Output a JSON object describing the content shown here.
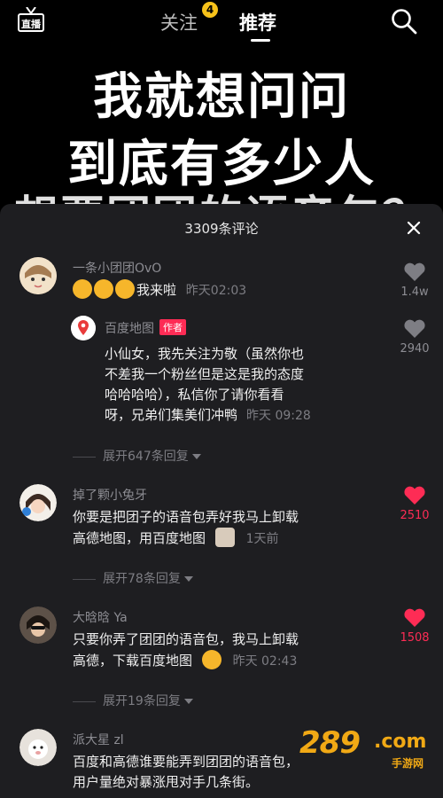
{
  "topbar": {
    "live_label": "直播",
    "follow_label": "关注",
    "follow_badge": "4",
    "recommend_label": "推荐"
  },
  "caption": {
    "line1": "我就想问问",
    "line2": "到底有多少人",
    "line3": "想要团团的语音包？"
  },
  "comments_sheet": {
    "title": "3309条评论",
    "comments": [
      {
        "username": "一条小团团OvO",
        "text": "我来啦",
        "time": "昨天02:03",
        "likes": "1.4w",
        "liked": false,
        "emoji_count": 3
      },
      {
        "username": "百度地图",
        "author_tag": "作者",
        "lines": [
          "小仙女，我先关注为敬（虽然你也",
          "不差我一个粉丝但是这是我的态度",
          "哈哈哈哈），私信你了请你看看",
          "呀，兄弟们集美们冲鸭"
        ],
        "time": "昨天 09:28",
        "likes": "2940",
        "liked": false,
        "expand": "展开647条回复"
      },
      {
        "username": "掉了颗小兔牙",
        "lines": [
          "你要是把团子的语音包弄好我马上卸载",
          "高德地图，用百度地图"
        ],
        "time": "1天前",
        "likes": "2510",
        "liked": true,
        "expand": "展开78条回复"
      },
      {
        "username": "大晗晗 Ya",
        "lines": [
          "只要你弄了团团的语音包，我马上卸载",
          "高德，下载百度地图"
        ],
        "time": "昨天 02:43",
        "likes": "1508",
        "liked": true,
        "expand": "展开19条回复"
      },
      {
        "username": "派大星 zl",
        "lines": [
          "百度和高德谁要能弄到团团的语音包，",
          "用户量绝对暴涨甩对手几条街。"
        ]
      }
    ]
  },
  "watermark": {
    "number": "289",
    "domain": ".com",
    "sub": "手游网"
  },
  "colors": {
    "accent_red": "#fe2c55",
    "badge_yellow": "#f7c21a",
    "sheet_bg": "#1e1e21",
    "watermark": "#f1a915"
  },
  "icons": {
    "live": "tv-live-icon",
    "search": "search-icon",
    "close": "close-icon",
    "like": "heart-icon"
  }
}
